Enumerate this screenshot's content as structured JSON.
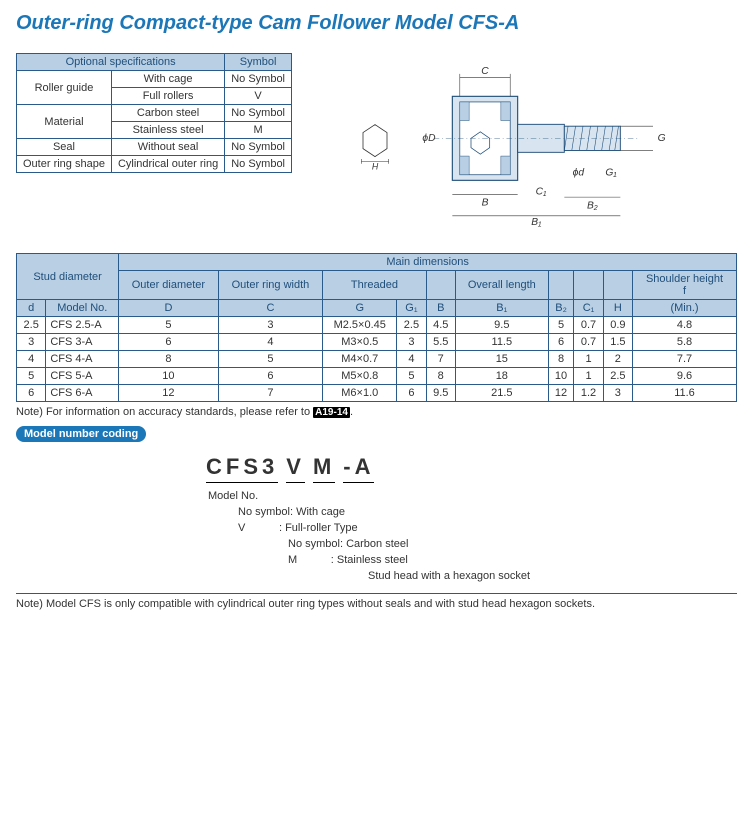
{
  "title": "Outer-ring Compact-type Cam Follower Model CFS-A",
  "spec": {
    "h_optional": "Optional specifications",
    "h_symbol": "Symbol",
    "rows": [
      {
        "cat": "Roller guide",
        "opt": "With cage",
        "sym": "No Symbol"
      },
      {
        "cat": "",
        "opt": "Full rollers",
        "sym": "V"
      },
      {
        "cat": "Material",
        "opt": "Carbon steel",
        "sym": "No Symbol"
      },
      {
        "cat": "",
        "opt": "Stainless steel",
        "sym": "M"
      },
      {
        "cat": "Seal",
        "opt": "Without seal",
        "sym": "No Symbol"
      },
      {
        "cat": "Outer ring shape",
        "opt": "Cylindrical outer ring",
        "sym": "No Symbol"
      }
    ]
  },
  "diagram_labels": {
    "C": "C",
    "D": "ϕD",
    "H": "H",
    "B": "B",
    "B1": "B₁",
    "B2": "B₂",
    "C1": "C₁",
    "d": "ϕd",
    "G": "G",
    "G1": "G₁"
  },
  "dim": {
    "group_stud": "Stud diameter",
    "group_main": "Main dimensions",
    "h_outer_dia": "Outer diameter",
    "h_ring_width": "Outer ring width",
    "h_threaded": "Threaded",
    "h_overall": "Overall length",
    "h_shoulder": "Shoulder height",
    "h_f": "f",
    "h_min": "(Min.)",
    "cols": [
      "d",
      "Model No.",
      "D",
      "C",
      "G",
      "G₁",
      "B",
      "B₁",
      "B₂",
      "C₁",
      "H",
      ""
    ],
    "rows": [
      {
        "d": "2.5",
        "model": "CFS 2.5-A",
        "D": "5",
        "C": "3",
        "G": "M2.5×0.45",
        "G1": "2.5",
        "B": "4.5",
        "B1": "9.5",
        "B2": "5",
        "C1": "0.7",
        "H": "0.9",
        "f": "4.8"
      },
      {
        "d": "3",
        "model": "CFS 3-A",
        "D": "6",
        "C": "4",
        "G": "M3×0.5",
        "G1": "3",
        "B": "5.5",
        "B1": "11.5",
        "B2": "6",
        "C1": "0.7",
        "H": "1.5",
        "f": "5.8"
      },
      {
        "d": "4",
        "model": "CFS 4-A",
        "D": "8",
        "C": "5",
        "G": "M4×0.7",
        "G1": "4",
        "B": "7",
        "B1": "15",
        "B2": "8",
        "C1": "1",
        "H": "2",
        "f": "7.7"
      },
      {
        "d": "5",
        "model": "CFS 5-A",
        "D": "10",
        "C": "6",
        "G": "M5×0.8",
        "G1": "5",
        "B": "8",
        "B1": "18",
        "B2": "10",
        "C1": "1",
        "H": "2.5",
        "f": "9.6"
      },
      {
        "d": "6",
        "model": "CFS 6-A",
        "D": "12",
        "C": "7",
        "G": "M6×1.0",
        "G1": "6",
        "B": "9.5",
        "B1": "21.5",
        "B2": "12",
        "C1": "1.2",
        "H": "3",
        "f": "11.6"
      }
    ]
  },
  "note1_pre": "Note) For information on accuracy standards, please refer to ",
  "note1_ref": "A19-14",
  "note1_post": ".",
  "badge": "Model number coding",
  "coding": {
    "parts": [
      "CFS3",
      "V",
      "M",
      "-A"
    ],
    "l_model": "Model No.",
    "l_cage_a": "No symbol: With cage",
    "l_cage_b": "V           : Full-roller Type",
    "l_mat_a": "No symbol: Carbon steel",
    "l_mat_b": "M           : Stainless steel",
    "l_stud": "Stud head with a hexagon socket"
  },
  "note2": "Note) Model CFS is only compatible with cylindrical outer ring types without seals and with stud head hexagon sockets."
}
